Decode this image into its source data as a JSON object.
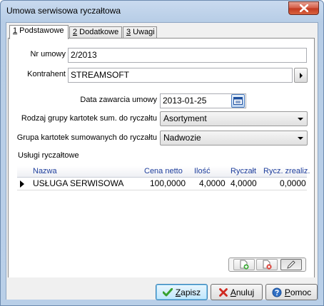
{
  "window": {
    "title": "Umowa serwisowa ryczałtowa"
  },
  "tabs": [
    {
      "key": "1",
      "label": " Podstawowe"
    },
    {
      "key": "2",
      "label": " Dodatkowe"
    },
    {
      "key": "3",
      "label": " Uwagi"
    }
  ],
  "form": {
    "nr_umowy_label": "Nr umowy",
    "nr_umowy_value": "2/2013",
    "kontrahent_label": "Kontrahent",
    "kontrahent_value": "STREAMSOFT",
    "data_label": "Data zawarcia umowy",
    "data_value": "2013-01-25",
    "rodzaj_label": "Rodzaj grupy kartotek sum. do ryczałtu",
    "rodzaj_value": "Asortyment",
    "grupa_label": "Grupa kartotek sumowanych do ryczałtu",
    "grupa_value": "Nadwozie",
    "uslugi_label": "Usługi ryczałtowe"
  },
  "grid": {
    "columns": [
      "Nazwa",
      "Cena netto",
      "Ilość",
      "Ryczałt",
      "Rycz. zrealiz."
    ],
    "rows": [
      [
        "USŁUGA SERWISOWA",
        "100,0000",
        "4,0000",
        "4,0000",
        "0,0000"
      ]
    ]
  },
  "buttons": {
    "save_key": "Z",
    "save_rest": "apisz",
    "cancel_key": "A",
    "cancel_rest": "nuluj",
    "help_key": "P",
    "help_rest": "omoc"
  }
}
